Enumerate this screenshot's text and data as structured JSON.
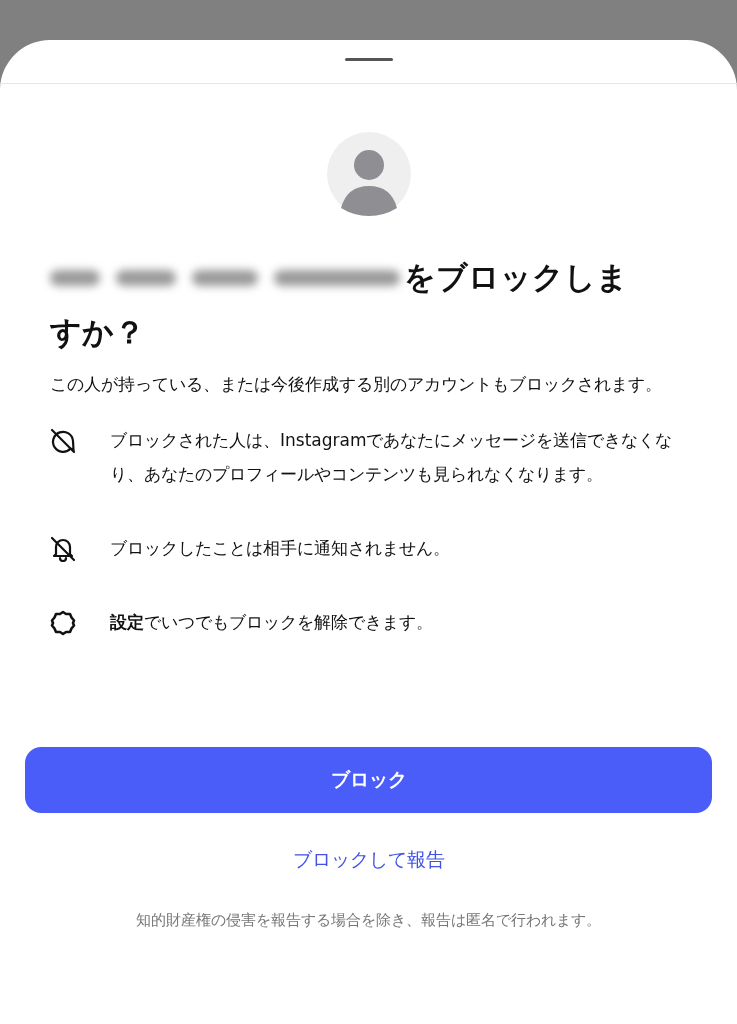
{
  "title_lines": [
    "をブロックしま",
    "すか？"
  ],
  "description": "この人が持っている、または今後作成する別のアカウントもブロックされます。",
  "items": [
    {
      "kind": "message",
      "text": "ブロックされた人は、Instagramであなたにメッセージを送信できなくなり、あなたのプロフィールやコンテンツも見られなくなります。"
    },
    {
      "kind": "notification",
      "text": "ブロックしたことは相手に通知されません。"
    },
    {
      "kind": "settings",
      "text": "**設定**でいつでもブロックを解除できます。"
    }
  ],
  "primary_button": "ブロック",
  "secondary_link": "ブロックして報告",
  "footnote": "知的財産権の侵害を報告する場合を除き、報告は匿名で行われます。"
}
